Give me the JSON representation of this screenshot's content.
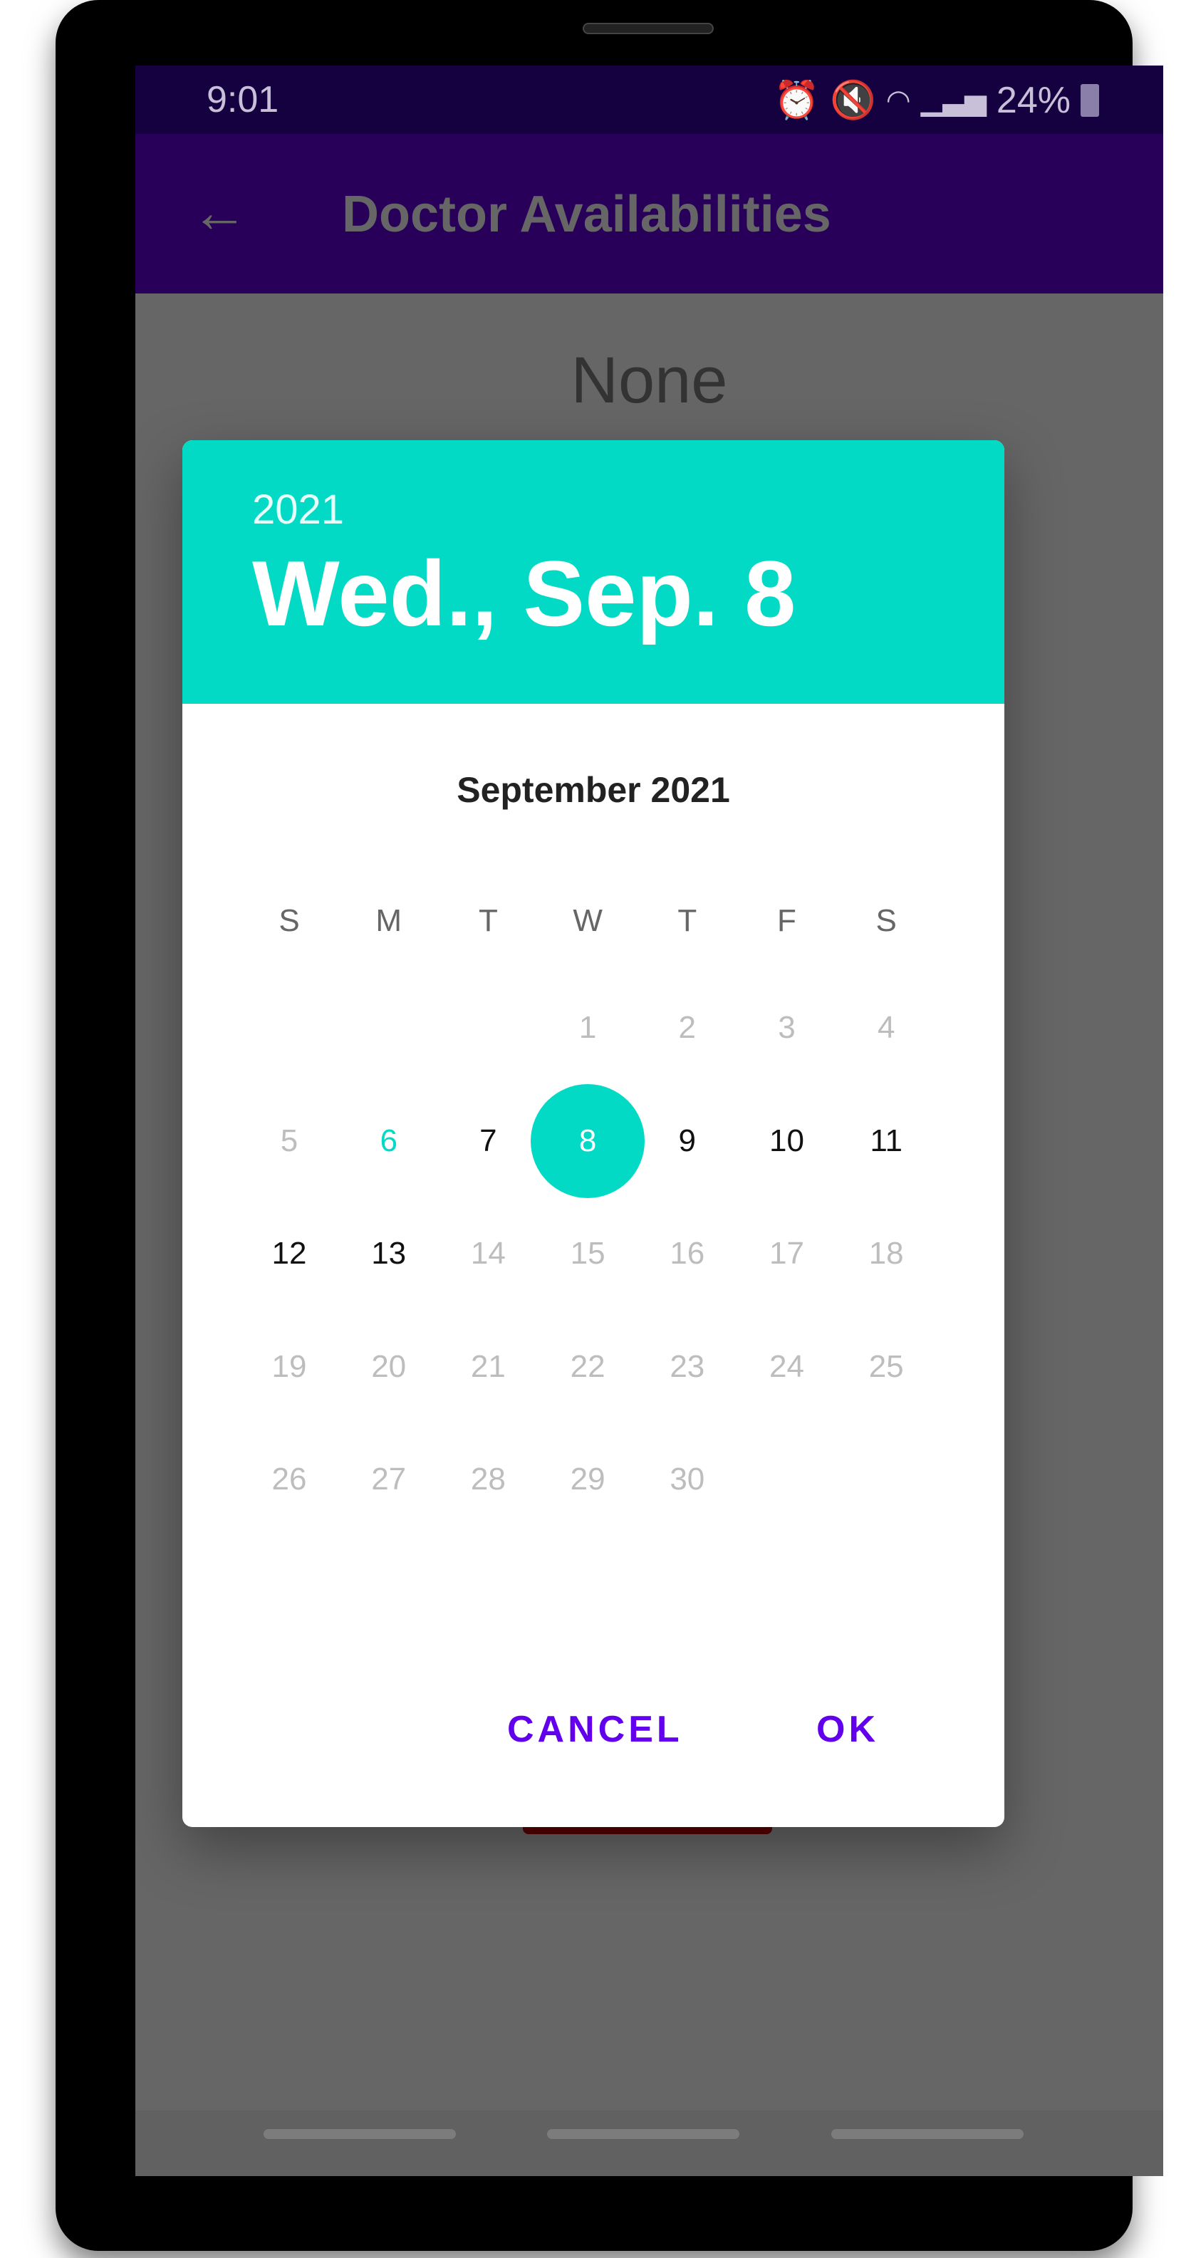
{
  "status_bar": {
    "time": "9:01",
    "battery": "24%",
    "icons": [
      "alarm-icon",
      "mute-icon",
      "wifi-icon",
      "signal-icon",
      "battery-charging-icon"
    ]
  },
  "app_bar": {
    "title": "Doctor Availabilities",
    "back_icon": "arrow-left-icon"
  },
  "content": {
    "text": "None"
  },
  "date_picker": {
    "year": "2021",
    "selected_date": "Wed., Sep. 8",
    "month_title": "September 2021",
    "weekdays": [
      "S",
      "M",
      "T",
      "W",
      "T",
      "F",
      "S"
    ],
    "first_weekday_index": 3,
    "days_in_month": 30,
    "selected_day": 8,
    "today": 6,
    "enabled_days": [
      6,
      7,
      8,
      9,
      10,
      11,
      12,
      13
    ],
    "cancel_label": "CANCEL",
    "ok_label": "OK",
    "accent_color": "#03DAC5",
    "button_color": "#6200EE"
  }
}
